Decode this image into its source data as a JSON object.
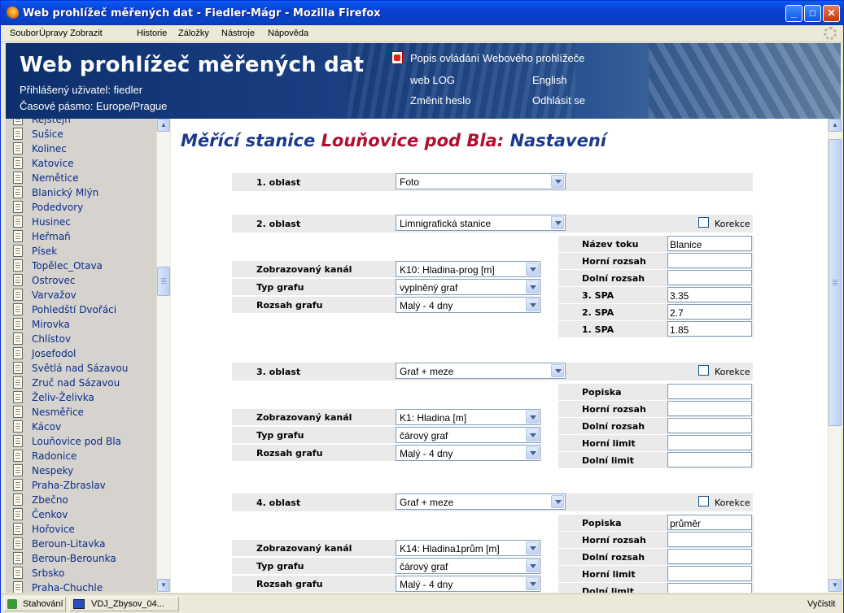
{
  "window": {
    "title": "Web prohlížeč měřených dat - Fiedler-Mágr - Mozilla Firefox"
  },
  "menu": [
    "Soubor",
    "Úpravy",
    "Zobrazit",
    "Historie",
    "Záložky",
    "Nástroje",
    "Nápověda"
  ],
  "header": {
    "title": "Web prohlížeč měřených dat",
    "user": "Přihlášený uživatel: fiedler",
    "timezone": "Časové pásmo: Europe/Prague",
    "help_link": "Popis ovládání Webového prohlížeče",
    "weblog_link": "web LOG",
    "english_link": "English",
    "change_password_link": "Změnit heslo",
    "logout_link": "Odhlásit se"
  },
  "sidebar": {
    "items": [
      "Rejstějn",
      "Sušice",
      "Kolinec",
      "Katovice",
      "Nemětice",
      "Blanický Mlýn",
      "Podedvory",
      "Husinec",
      "Heřmaň",
      "Písek",
      "Topělec_Otava",
      "Ostrovec",
      "Varvažov",
      "Pohledští Dvořáci",
      "Mirovka",
      "Chlístov",
      "Josefodol",
      "Světlá nad Sázavou",
      "Zruč nad Sázavou",
      "Želiv-Želivka",
      "Nesměřice",
      "Kácov",
      "Louňovice pod Bla",
      "Radonice",
      "Nespeky",
      "Praha-Zbraslav",
      "Zbečno",
      "Čenkov",
      "Hořovice",
      "Beroun-Litavka",
      "Beroun-Berounka",
      "Srbsko",
      "Praha-Chuchle"
    ]
  },
  "page": {
    "title_a": "Měřící stanice",
    "station": "Louňovice pod Bla:",
    "title_b": "Nastavení"
  },
  "area1": {
    "label": "1. oblast",
    "value": "Foto"
  },
  "area2": {
    "label": "2. oblast",
    "value": "Limnigrafická stanice",
    "korekce": "Korekce",
    "channel_label": "Zobrazovaný kanál",
    "channel": "K10: Hladina-prog [m]",
    "type_label": "Typ grafu",
    "type": "vyplněný graf",
    "range_label": "Rozsah grafu",
    "range": "Malý - 4 dny",
    "fields": [
      {
        "label": "Název toku",
        "value": "Blanice"
      },
      {
        "label": "Horní rozsah",
        "value": ""
      },
      {
        "label": "Dolní rozsah",
        "value": ""
      },
      {
        "label": "3. SPA",
        "value": "3.35"
      },
      {
        "label": "2. SPA",
        "value": "2.7"
      },
      {
        "label": "1. SPA",
        "value": "1.85"
      }
    ]
  },
  "area3": {
    "label": "3. oblast",
    "value": "Graf + meze",
    "korekce": "Korekce",
    "channel_label": "Zobrazovaný kanál",
    "channel": "K1: Hladina [m]",
    "type_label": "Typ grafu",
    "type": "čárový graf",
    "range_label": "Rozsah grafu",
    "range": "Malý - 4 dny",
    "fields": [
      {
        "label": "Popiska",
        "value": ""
      },
      {
        "label": "Horní rozsah",
        "value": ""
      },
      {
        "label": "Dolní rozsah",
        "value": ""
      },
      {
        "label": "Horní limit",
        "value": ""
      },
      {
        "label": "Dolní limit",
        "value": ""
      }
    ]
  },
  "area4": {
    "label": "4. oblast",
    "value": "Graf + meze",
    "korekce": "Korekce",
    "channel_label": "Zobrazovaný kanál",
    "channel": "K14: Hladina1prům [m]",
    "type_label": "Typ grafu",
    "type": "čárový graf",
    "range_label": "Rozsah grafu",
    "range": "Malý - 4 dny",
    "fields": [
      {
        "label": "Popiska",
        "value": "průměr"
      },
      {
        "label": "Horní rozsah",
        "value": ""
      },
      {
        "label": "Dolní rozsah",
        "value": ""
      },
      {
        "label": "Horní limit",
        "value": ""
      },
      {
        "label": "Dolní limit",
        "value": ""
      }
    ]
  },
  "statusbar": {
    "downloads": "Stahování",
    "task": "VDJ_Zbysov_04...",
    "clear": "Vyčistit"
  },
  "colors": {
    "title_blue": "#1c3a8a",
    "station_red": "#b01030",
    "header_bg": "#14397a",
    "sidebar_bg": "#d6d3ce"
  }
}
